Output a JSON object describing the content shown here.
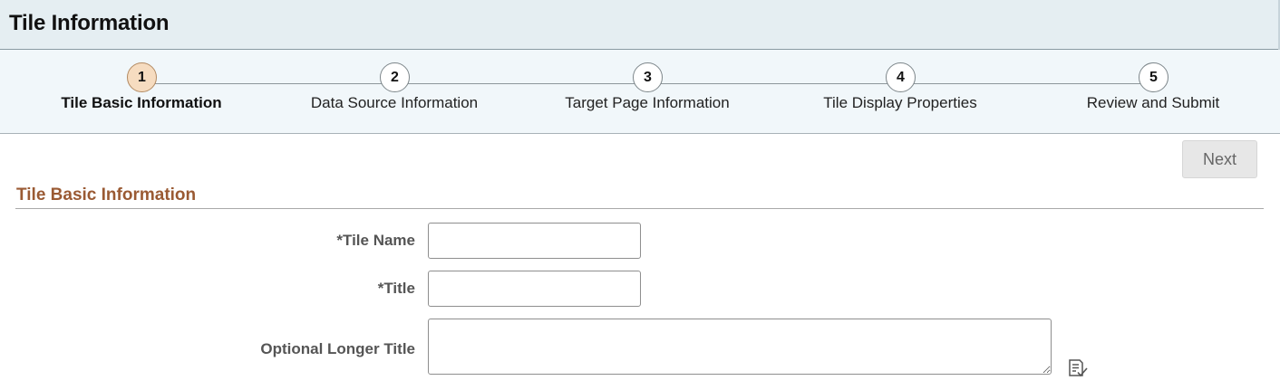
{
  "header": {
    "title": "Tile Information"
  },
  "steps": [
    {
      "number": "1",
      "label": "Tile Basic Information",
      "active": true
    },
    {
      "number": "2",
      "label": "Data Source Information",
      "active": false
    },
    {
      "number": "3",
      "label": "Target Page Information",
      "active": false
    },
    {
      "number": "4",
      "label": "Tile Display Properties",
      "active": false
    },
    {
      "number": "5",
      "label": "Review and Submit",
      "active": false
    }
  ],
  "toolbar": {
    "next_label": "Next"
  },
  "section": {
    "title": "Tile Basic Information"
  },
  "form": {
    "tile_name": {
      "label": "*Tile Name",
      "value": ""
    },
    "title": {
      "label": "*Title",
      "value": ""
    },
    "optional_longer_title": {
      "label": "Optional Longer Title",
      "value": ""
    }
  },
  "icons": {
    "spell_check": "spell-check-icon"
  },
  "colors": {
    "header_bg": "#e5eef2",
    "steps_bg": "#f1f7fa",
    "active_step": "#f6dcc0",
    "section_title": "#9a5a33"
  }
}
